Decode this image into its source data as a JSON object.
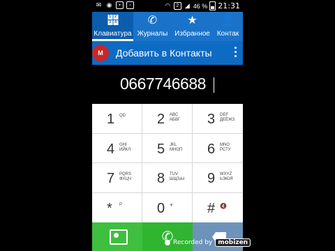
{
  "status_bar": {
    "sim_label": "2",
    "battery_percent": "46 %",
    "time": "21:31",
    "icons": [
      "message-icon",
      "circle-icon",
      "image-icon",
      "screen-icon",
      "wifi-icon",
      "sim-icon",
      "signal-icon",
      "battery-icon"
    ]
  },
  "tabs": [
    {
      "label": "Клавиатура",
      "icon": "keypad-icon",
      "active": true
    },
    {
      "label": "Журналы",
      "icon": "call-log-icon",
      "active": false
    },
    {
      "label": "Избранное",
      "icon": "star-icon",
      "active": false
    },
    {
      "label": "Контак",
      "icon": "contacts-icon",
      "active": false
    }
  ],
  "action_bar": {
    "title": "Добавить в Контакты",
    "menu_icon": "overflow-menu-icon"
  },
  "dialed_number": "0667746688",
  "keypad": {
    "keys": [
      {
        "digit": "1",
        "letters": "QD"
      },
      {
        "digit": "2",
        "letters": "ABC\nАБВГ"
      },
      {
        "digit": "3",
        "letters": "DEF\nДЕЁЖЗ"
      },
      {
        "digit": "4",
        "letters": "GHI\nИЙКЛ"
      },
      {
        "digit": "5",
        "letters": "JKL\nМНОП"
      },
      {
        "digit": "6",
        "letters": "MNO\nРСТУ"
      },
      {
        "digit": "7",
        "letters": "PQRS\nФХЦЧ"
      },
      {
        "digit": "8",
        "letters": "TUV\nШЩЪЫ"
      },
      {
        "digit": "9",
        "letters": "WXYZ\nЬЭЮЯ"
      },
      {
        "digit": "*",
        "letters": "P"
      },
      {
        "digit": "0",
        "letters": "+"
      },
      {
        "digit": "#",
        "letters": "mute-icon"
      }
    ]
  },
  "bottom_bar": {
    "add_contact_icon": "add-contact-icon",
    "call_icon": "phone-icon",
    "delete_icon": "backspace-icon"
  },
  "watermark": {
    "text": "Recorded by",
    "brand": "mobizen"
  },
  "colors": {
    "tab_bar": "#1a73c9",
    "action_bar": "#0d6bc4",
    "call_green": "#2fb52f",
    "delete_blue": "#6e93ba"
  }
}
